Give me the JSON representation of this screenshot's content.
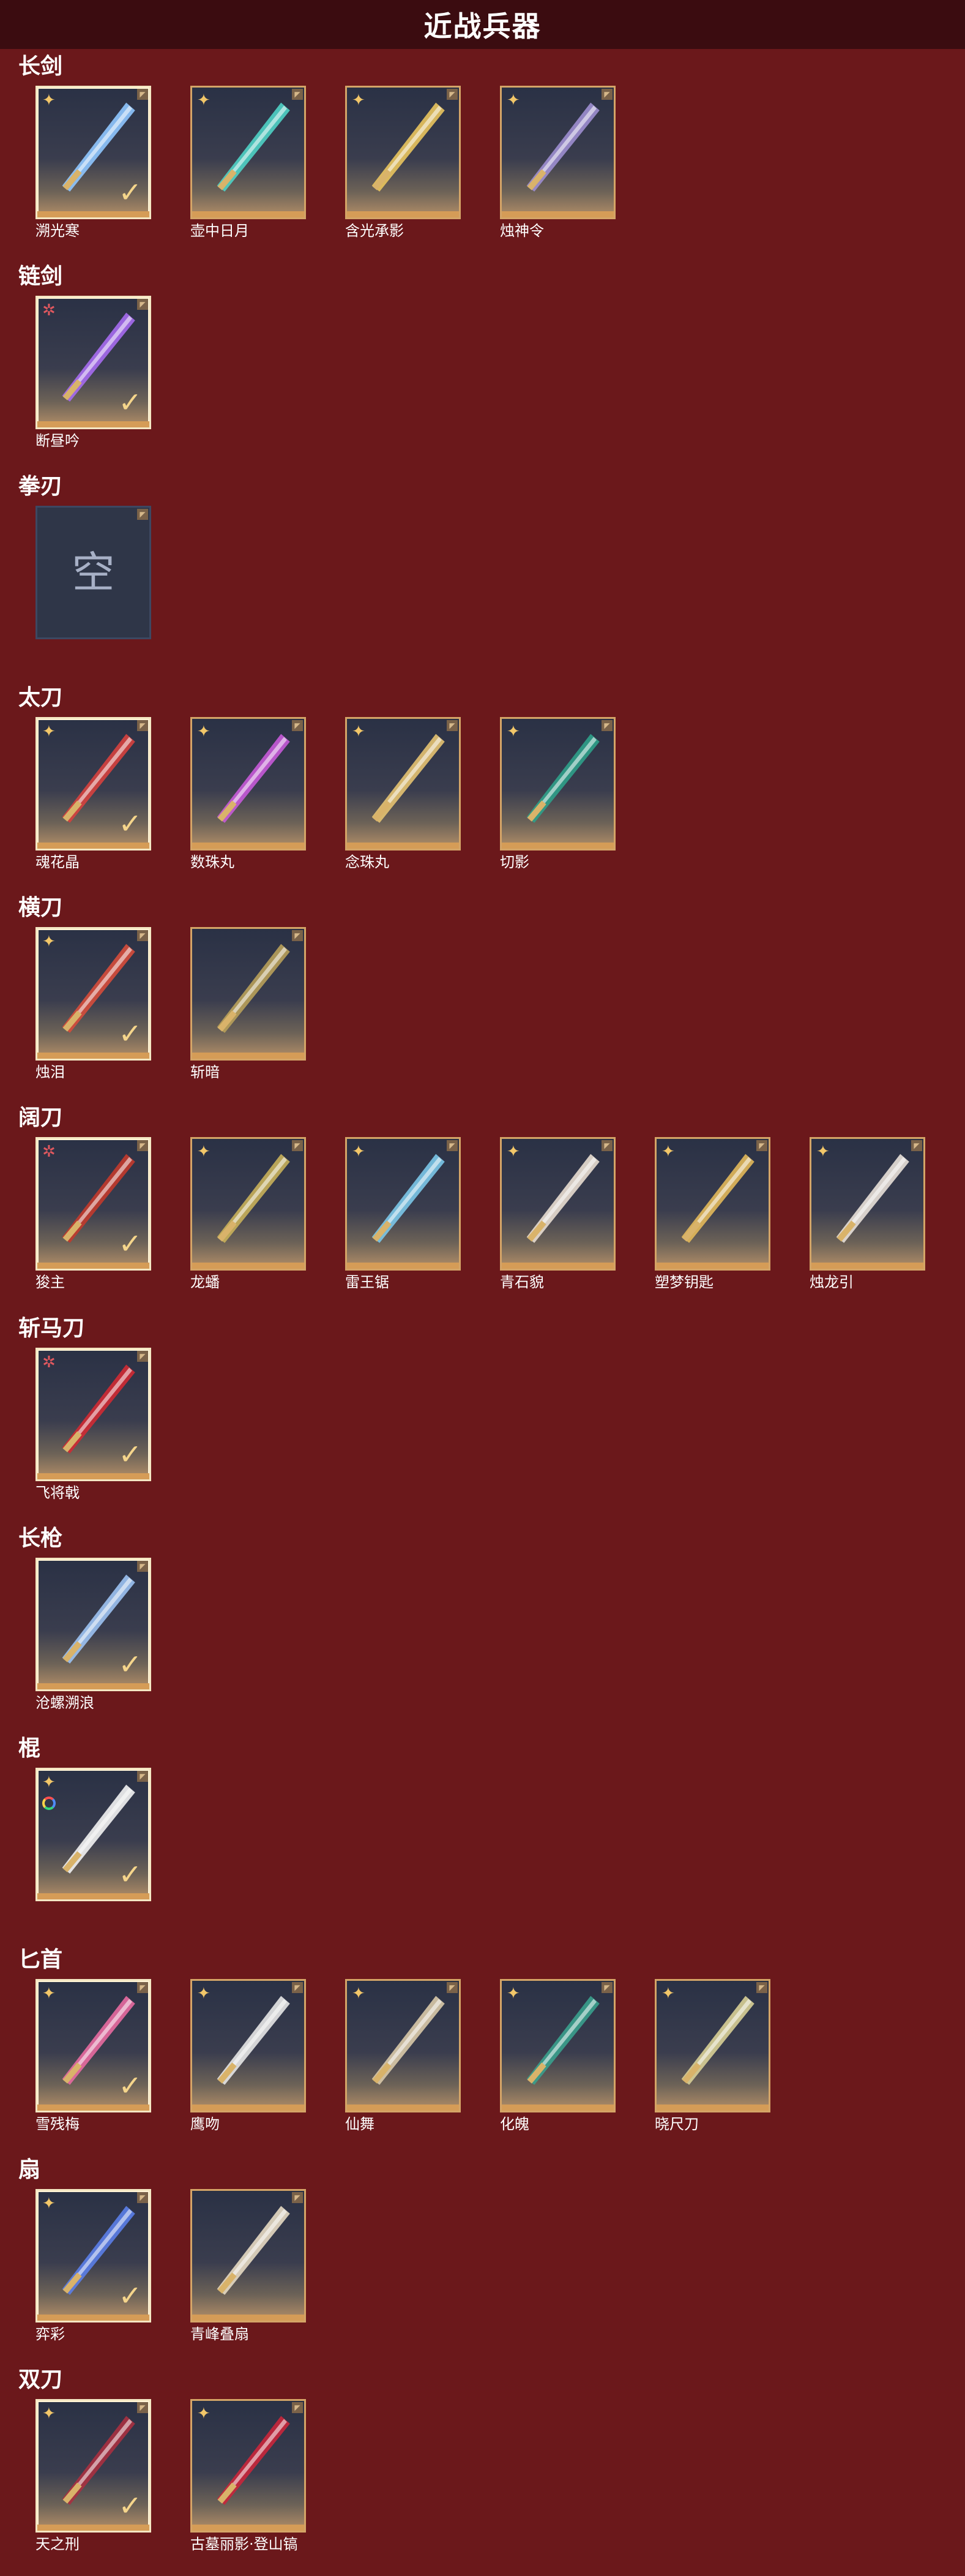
{
  "header": {
    "title": "近战兵器"
  },
  "colors": {
    "background": "#6b181b",
    "header": "#3b0c10",
    "card_border": "#d4a467",
    "accent_gold": "#f2c769"
  },
  "categories": [
    {
      "title": "长剑",
      "items": [
        {
          "name": "溯光寒",
          "rank": "gold",
          "checked": true,
          "art": "#8fc7ff"
        },
        {
          "name": "壶中日月",
          "rank": "gold",
          "checked": false,
          "art": "#4fd1c5"
        },
        {
          "name": "含光承影",
          "rank": "gold",
          "checked": false,
          "art": "#e9c45e"
        },
        {
          "name": "烛神令",
          "rank": "gold",
          "checked": false,
          "art": "#9d8ed0"
        }
      ]
    },
    {
      "title": "链剑",
      "items": [
        {
          "name": "断昼吟",
          "rank": "red",
          "checked": true,
          "art": "#a66cf0"
        }
      ]
    },
    {
      "title": "拳刃",
      "items": [
        {
          "name": "",
          "rank": "",
          "checked": false,
          "empty": true,
          "empty_label": "空"
        }
      ]
    },
    {
      "title": "太刀",
      "items": [
        {
          "name": "魂花晶",
          "rank": "gold",
          "checked": true,
          "art": "#d6413e"
        },
        {
          "name": "数珠丸",
          "rank": "gold",
          "checked": false,
          "art": "#c75ad8"
        },
        {
          "name": "念珠丸",
          "rank": "gold",
          "checked": false,
          "art": "#e4c271"
        },
        {
          "name": "切影",
          "rank": "gold",
          "checked": false,
          "art": "#2fa08a"
        }
      ]
    },
    {
      "title": "横刀",
      "items": [
        {
          "name": "烛泪",
          "rank": "gold",
          "checked": true,
          "art": "#d64d3b"
        },
        {
          "name": "斩暗",
          "rank": "",
          "checked": false,
          "art": "#b8a05a"
        }
      ]
    },
    {
      "title": "阔刀",
      "items": [
        {
          "name": "狻主",
          "rank": "red",
          "checked": true,
          "art": "#c23a2c"
        },
        {
          "name": "龙蟠",
          "rank": "gold",
          "checked": false,
          "art": "#c8b05a"
        },
        {
          "name": "雷王锯",
          "rank": "gold",
          "checked": false,
          "art": "#7bc6e8"
        },
        {
          "name": "青石貌",
          "rank": "gold",
          "checked": false,
          "art": "#e8ddd0"
        },
        {
          "name": "塑梦钥匙",
          "rank": "gold",
          "checked": false,
          "art": "#e2b85a"
        },
        {
          "name": "烛龙引",
          "rank": "gold",
          "checked": false,
          "art": "#e8e0d8"
        }
      ]
    },
    {
      "title": "斩马刀",
      "items": [
        {
          "name": "飞将戟",
          "rank": "red",
          "checked": true,
          "art": "#d02a33"
        }
      ]
    },
    {
      "title": "长枪",
      "items": [
        {
          "name": "沧螺溯浪",
          "rank": "",
          "checked": true,
          "art": "#9cc2f2"
        }
      ]
    },
    {
      "title": "棍",
      "items": [
        {
          "name": "",
          "rank": "gold",
          "checked": true,
          "art": "#f2f2f2",
          "rainbow": true
        }
      ]
    },
    {
      "title": "匕首",
      "items": [
        {
          "name": "雪残梅",
          "rank": "gold",
          "checked": true,
          "art": "#e86aa0"
        },
        {
          "name": "鹰吻",
          "rank": "gold",
          "checked": false,
          "art": "#e6e6e6"
        },
        {
          "name": "仙舞",
          "rank": "gold",
          "checked": false,
          "art": "#d9c9a8"
        },
        {
          "name": "化魄",
          "rank": "gold",
          "checked": false,
          "art": "#3aa08d"
        },
        {
          "name": "晓尺刀",
          "rank": "gold",
          "checked": false,
          "art": "#d8cf96"
        }
      ]
    },
    {
      "title": "扇",
      "items": [
        {
          "name": "弈彩",
          "rank": "gold",
          "checked": true,
          "art": "#5b7ee8"
        },
        {
          "name": "青峰叠扇",
          "rank": "",
          "checked": false,
          "art": "#e6d9c2"
        }
      ]
    },
    {
      "title": "双刀",
      "items": [
        {
          "name": "天之刑",
          "rank": "gold",
          "checked": true,
          "art": "#a83040"
        },
        {
          "name": "古墓丽影·登山镐",
          "rank": "gold",
          "checked": false,
          "art": "#c9263b"
        }
      ]
    }
  ]
}
